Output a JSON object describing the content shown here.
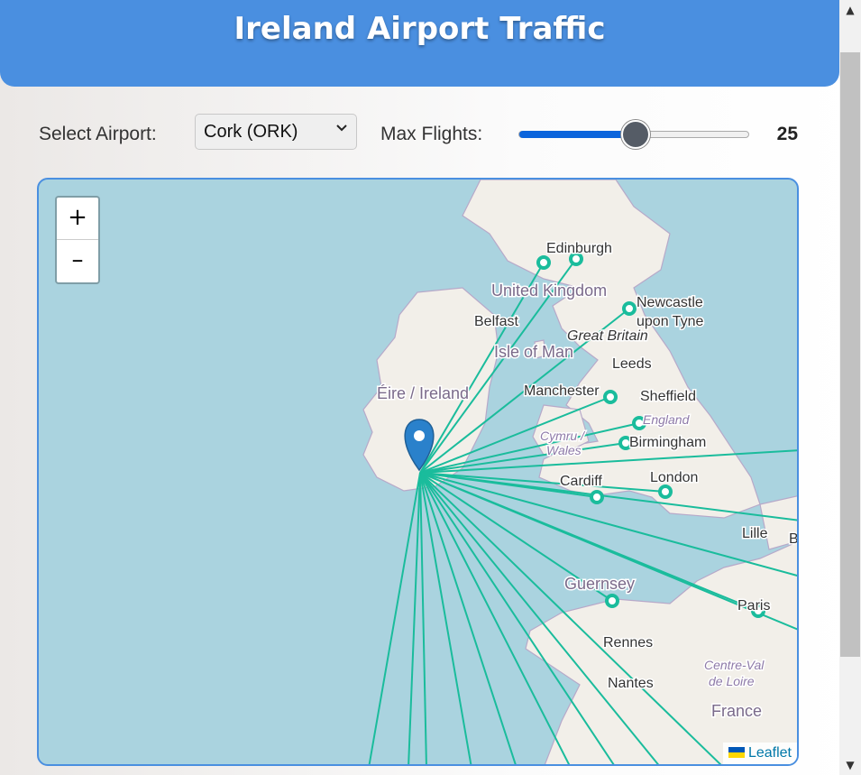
{
  "header": {
    "title": "Ireland Airport Traffic"
  },
  "controls": {
    "airport_label": "Select Airport:",
    "airport_value": "Cork (ORK)",
    "flights_label": "Max Flights:",
    "flights_value": "25",
    "slider_fraction": 0.5
  },
  "map": {
    "zoom_in": "+",
    "zoom_out": "–",
    "attribution": "Leaflet",
    "route_color": "#1abc9c",
    "marker_color": "#2a81cb",
    "labels": {
      "edinburgh": "Edinburgh",
      "united_kingdom": "United Kingdom",
      "newcastle_1": "Newcastle",
      "newcastle_2": "upon Tyne",
      "belfast": "Belfast",
      "great_britain": "Great Britain",
      "isle_of_man": "Isle of Man",
      "leeds": "Leeds",
      "eire": "Éire / Ireland",
      "manchester": "Manchester",
      "sheffield": "Sheffield",
      "england": "England",
      "cymru": "Cymru /",
      "wales": "Wales",
      "birmingham": "Birmingham",
      "cardiff": "Cardiff",
      "london": "London",
      "lille": "Lille",
      "b_edge": "B",
      "guernsey": "Guernsey",
      "paris": "Paris",
      "rennes": "Rennes",
      "centre_val_1": "Centre-Val",
      "centre_val_2": "de Loire",
      "nantes": "Nantes",
      "france": "France"
    }
  }
}
